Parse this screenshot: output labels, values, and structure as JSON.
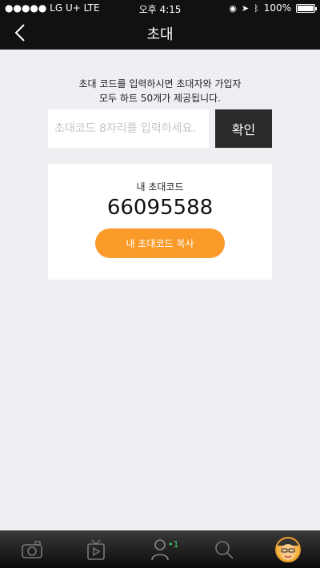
{
  "status_bar": {
    "carrier": "●●●●● LG U+  LTE",
    "time": "오후 4:15",
    "battery": "100%"
  },
  "nav": {
    "title": "초대"
  },
  "invite": {
    "description_line1": "초대 코드를 입력하시면 초대자와 가입자",
    "description_line2": "모두 하트 50개가 제공됩니다.",
    "input_placeholder": "초대코드 8자리를 입력하세요.",
    "input_value": "",
    "confirm_label": "확인"
  },
  "my_code": {
    "label": "내 초대코드",
    "code": "66095588",
    "copy_label": "내 초대코드 복사"
  },
  "tab_bar": {
    "badge": "•1",
    "tabs": [
      {
        "icon": "camera-icon"
      },
      {
        "icon": "tv-icon"
      },
      {
        "icon": "friends-icon"
      },
      {
        "icon": "search-icon"
      },
      {
        "icon": "profile-avatar"
      }
    ]
  },
  "colors": {
    "accent": "#fa9a28",
    "dark": "#111111",
    "background": "#efeef3",
    "badge": "#3fd26b"
  }
}
